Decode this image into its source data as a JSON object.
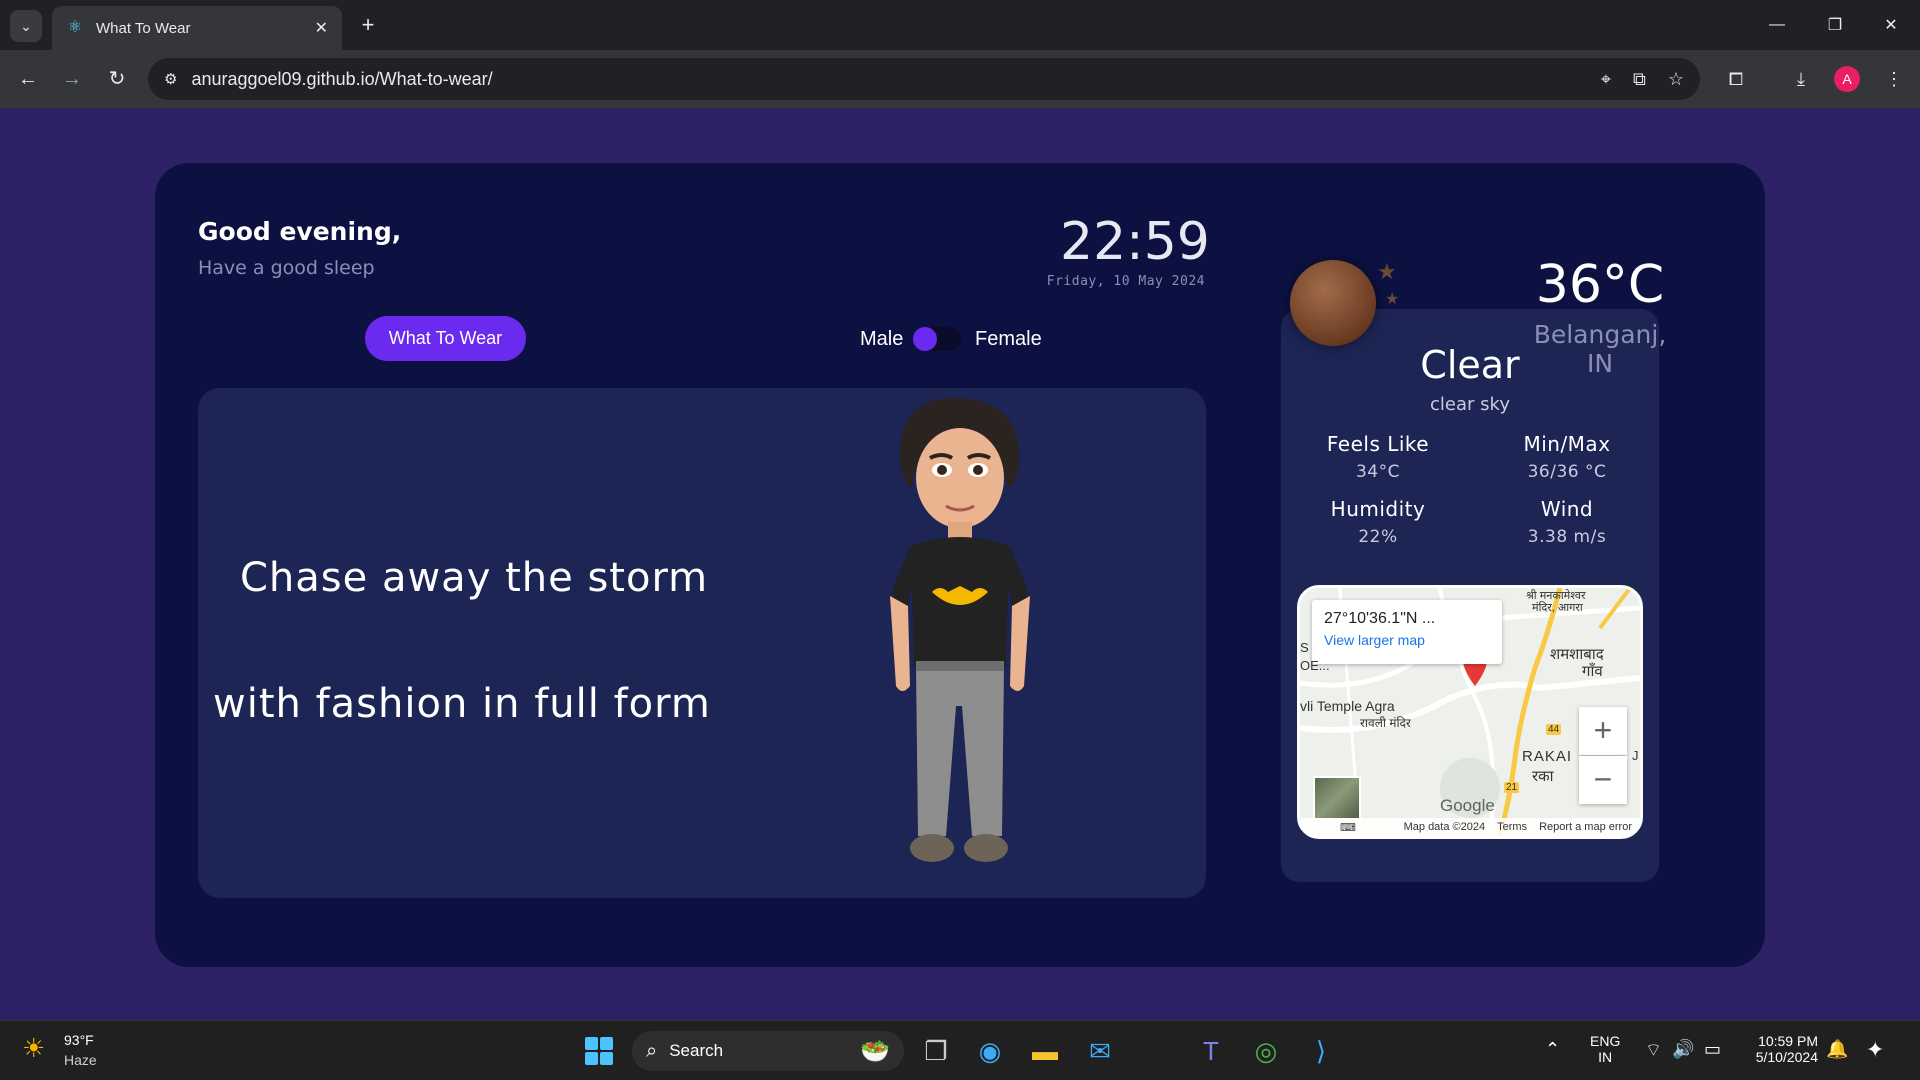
{
  "browser": {
    "tab_title": "What To Wear",
    "url": "anuraggoel09.github.io/What-to-wear/",
    "profile_initial": "A"
  },
  "greeting": {
    "title": "Good evening,",
    "subtitle": "Have a good sleep"
  },
  "clock": {
    "time": "22:59",
    "date": "Friday, 10 May 2024"
  },
  "controls": {
    "button_label": "What To Wear",
    "male_label": "Male",
    "female_label": "Female",
    "gender_toggle_on": false
  },
  "outfit": {
    "line1": "Chase away the storm",
    "line2": "with fashion in full form"
  },
  "weather": {
    "temperature": "36°C",
    "location": "Belanganj, IN",
    "condition": "Clear",
    "description": "clear sky",
    "stats": [
      {
        "label": "Feels Like",
        "value": "34°C"
      },
      {
        "label": "Min/Max",
        "value": "36/36 °C"
      },
      {
        "label": "Humidity",
        "value": "22%"
      },
      {
        "label": "Wind",
        "value": "3.38 m/s"
      }
    ]
  },
  "map": {
    "coordinates": "27°10'36.1\"N ...",
    "larger_map_link": "View larger map",
    "labels": {
      "temple": "vli Temple Agra",
      "temple_hindi": "रावली मंदिर",
      "area1": "शमशाबाद",
      "area1b": "गाँव",
      "area2": "RAKAI",
      "area2_hindi": "रका",
      "top_hindi": "श्री मनकामेश्वर",
      "top_hindi2": "मंदिर, आगरा",
      "left_edge": "OE...",
      "road_44": "44",
      "road_21": "21",
      "edge_j": "J",
      "edge_s": "S"
    },
    "google": "Google",
    "footer": {
      "data": "Map data ©2024",
      "terms": "Terms",
      "report": "Report a map error"
    }
  },
  "taskbar": {
    "weather_temp": "93°F",
    "weather_cond": "Haze",
    "search_label": "Search",
    "lang_top": "ENG",
    "lang_bottom": "IN",
    "time": "10:59 PM",
    "date": "5/10/2024"
  }
}
